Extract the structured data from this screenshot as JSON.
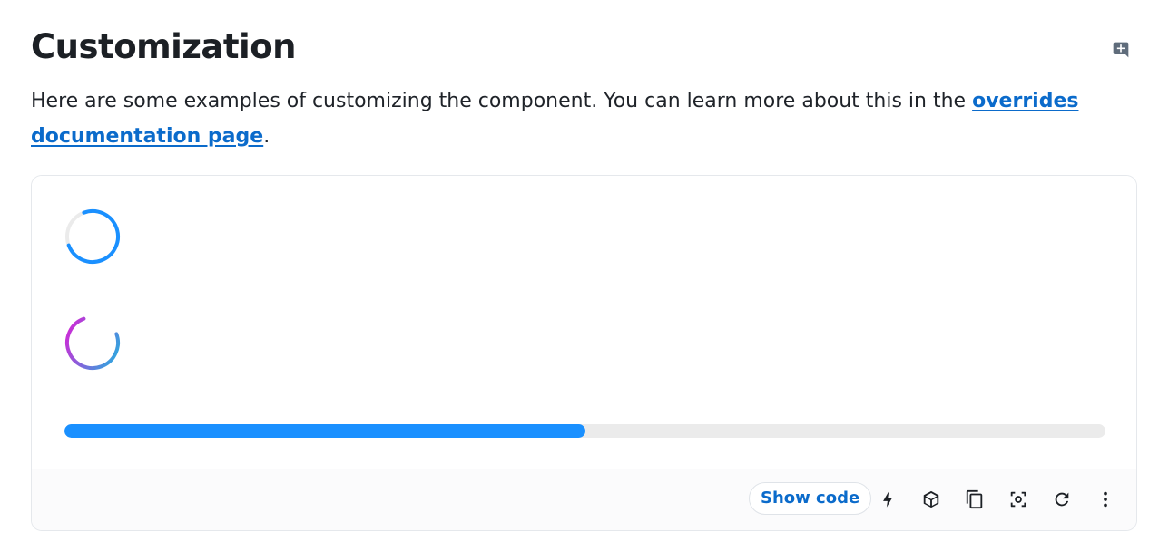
{
  "header": {
    "title": "Customization",
    "feedback_icon": "comment-add-icon"
  },
  "intro": {
    "text_before": "Here are some examples of customizing the component. You can learn more about this in the ",
    "link_text": "overrides documentation page",
    "text_after": "."
  },
  "demo": {
    "spinner_1": {
      "color": "#1a90ff",
      "track_color": "#ebebeb"
    },
    "spinner_2": {
      "gradient": [
        "#e01cd5",
        "#1cb5e0"
      ]
    },
    "progress": {
      "value_percent": 50,
      "fill_color": "#1a90ff",
      "track_color": "#ebebeb"
    }
  },
  "toolbar": {
    "show_code_label": "Show code",
    "icons": [
      "bolt-icon",
      "codesandbox-icon",
      "copy-icon",
      "screenshot-icon",
      "reset-icon",
      "more-vert-icon"
    ]
  },
  "colors": {
    "link": "#0b6bcb",
    "accent": "#1a90ff"
  }
}
